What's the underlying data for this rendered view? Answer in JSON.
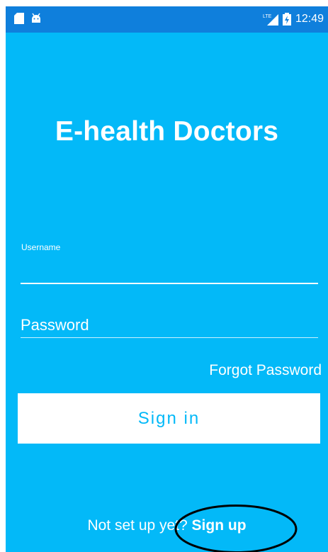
{
  "status_bar": {
    "time": "12:49",
    "network": "LTE",
    "icons": [
      "sd-card-icon",
      "android-debug-icon",
      "lte-signal-icon",
      "battery-charging-icon"
    ]
  },
  "app": {
    "title": "E-health Doctors"
  },
  "form": {
    "username_label": "Username",
    "username_value": "",
    "password_placeholder": "Password",
    "forgot_label": "Forgot Password",
    "signin_label": "Sign in"
  },
  "footer": {
    "prompt": "Not set up yet?",
    "signup_label": "Sign up"
  },
  "colors": {
    "background": "#03B9F8",
    "status_bar": "#0F7FDC",
    "text": "#FFFFFF",
    "button_text": "#03B9F8",
    "annotation": "#000000"
  }
}
